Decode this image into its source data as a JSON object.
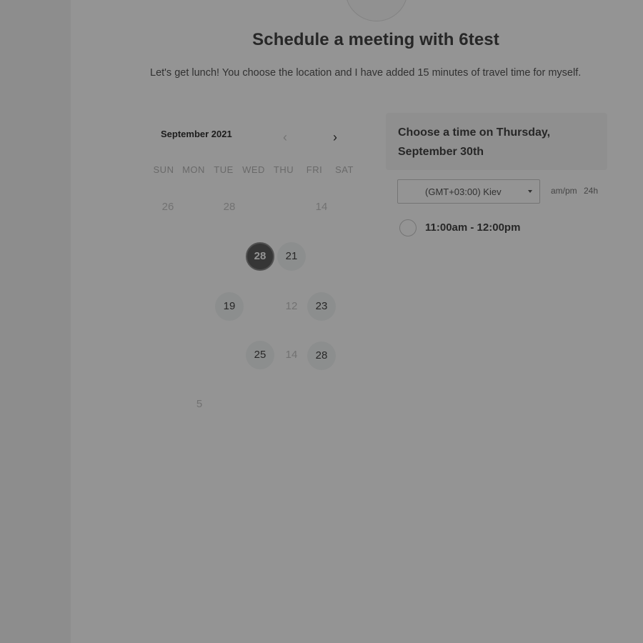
{
  "header": {
    "title": "Schedule a meeting with 6test",
    "description": "Let's get lunch! You choose the location and I have added 15 minutes of travel time for myself."
  },
  "calendar": {
    "month_label": "September 2021",
    "prev_icon": "chevron-left-icon",
    "next_icon": "chevron-right-icon",
    "weekdays": [
      "SUN",
      "MON",
      "TUE",
      "WED",
      "THU",
      "FRI",
      "SAT"
    ],
    "days": {
      "d0": "26",
      "d1": "28",
      "d2": "14",
      "d3": "28",
      "d4": "21",
      "d5": "19",
      "d6": "12",
      "d7": "23",
      "d8": "25",
      "d9": "14",
      "d10": "28",
      "d11": "5"
    },
    "selected_day": "28"
  },
  "time_panel": {
    "heading": "Choose a time on Thursday, September 30th",
    "timezone": "(GMT+03:00) Kiev",
    "format_ampm": "am/pm",
    "format_24h": "24h",
    "slots": [
      "11:00am - 12:00pm"
    ]
  },
  "colors": {
    "overlay": "rgba(0,0,0,0.42)",
    "selected_day": "#5e5e5e"
  }
}
